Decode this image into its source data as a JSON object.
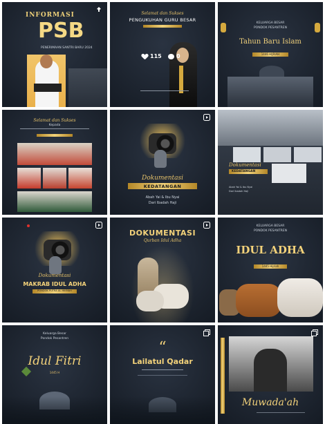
{
  "tiles": [
    {
      "id": "t1",
      "title": "INFORMASI",
      "big": "PSB",
      "sub": "PENERIMAAN SANTRI BARU 2024",
      "icon": "pin-icon"
    },
    {
      "id": "t2",
      "script": "Selamat dan Sukses",
      "title": "PENGUKUHAN GURU BESAR",
      "likes": "115",
      "comments": "0"
    },
    {
      "id": "t3",
      "line1": "KELUARGA BESAR",
      "line2": "PONDOK PESANTREN",
      "title": "Tahun Baru Islam",
      "date": "1446 HIJRIAH"
    },
    {
      "id": "t4",
      "script": "Selamat dan Sukses",
      "line": "Kepada",
      "date": ""
    },
    {
      "id": "t5",
      "script": "Dokumentasi",
      "title": "KEDATANGAN",
      "line1": "Abah Yai & Ibu Nyai",
      "line2": "Dari Ibadah Haji",
      "icon": "reel-icon"
    },
    {
      "id": "t6",
      "script": "Dokumentasi",
      "title": "KEDATANGAN",
      "line1": "Abah Yai & Ibu Nyai",
      "line2": "Dari Ibadah Haji"
    },
    {
      "id": "t7",
      "script": "Dokumentasi",
      "title": "MAKRAB IDUL ADHA",
      "sub": "PONDOK PUTRA AL HIKMAH",
      "icon": "reel-icon"
    },
    {
      "id": "t8",
      "title": "DOKUMENTASI",
      "script": "Qurban Idul Adha",
      "icon": "reel-icon"
    },
    {
      "id": "t9",
      "line1": "KELUARGA BESAR",
      "line2": "PONDOK PESANTREN",
      "title": "IDUL ADHA",
      "date": "1445 Hijriah"
    },
    {
      "id": "t10",
      "line1": "Keluarga Besar",
      "line2": "Pondok Pesantren",
      "title": "Idul Fitri",
      "date": "1445 H"
    },
    {
      "id": "t11",
      "quote": "“",
      "title": "Lailatul Qadar",
      "icon": "gallery-icon"
    },
    {
      "id": "t12",
      "title": "Muwada'ah",
      "icon": "gallery-icon"
    }
  ]
}
